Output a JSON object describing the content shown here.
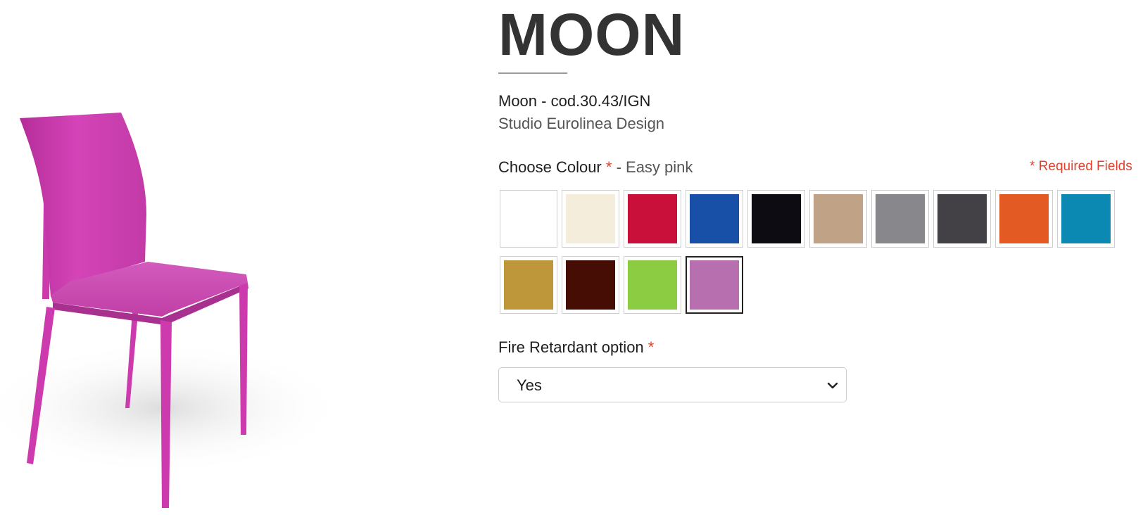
{
  "product": {
    "title": "MOON",
    "code_line": "Moon - cod.30.43/IGN",
    "designer": "Studio Eurolinea Design",
    "chair_color": "#cc3aad"
  },
  "colour": {
    "label": "Choose Colour",
    "required_mark": "*",
    "separator": "-",
    "selected_name": "Easy pink",
    "required_note": "* Required Fields",
    "swatches": [
      {
        "color": "#ffffff",
        "selected": false
      },
      {
        "color": "#f4eddb",
        "selected": false
      },
      {
        "color": "#c8103a",
        "selected": false
      },
      {
        "color": "#1850a8",
        "selected": false
      },
      {
        "color": "#0d0c12",
        "selected": false
      },
      {
        "color": "#c0a286",
        "selected": false
      },
      {
        "color": "#88888c",
        "selected": false
      },
      {
        "color": "#434146",
        "selected": false
      },
      {
        "color": "#e35a22",
        "selected": false
      },
      {
        "color": "#0b89b2",
        "selected": false
      },
      {
        "color": "#bd9739",
        "selected": false
      },
      {
        "color": "#460d04",
        "selected": false
      },
      {
        "color": "#8ccc42",
        "selected": false
      },
      {
        "color": "#b86fb0",
        "selected": true
      }
    ]
  },
  "fire_retardant": {
    "label": "Fire Retardant option",
    "required_mark": "*",
    "selected_value": "Yes"
  }
}
